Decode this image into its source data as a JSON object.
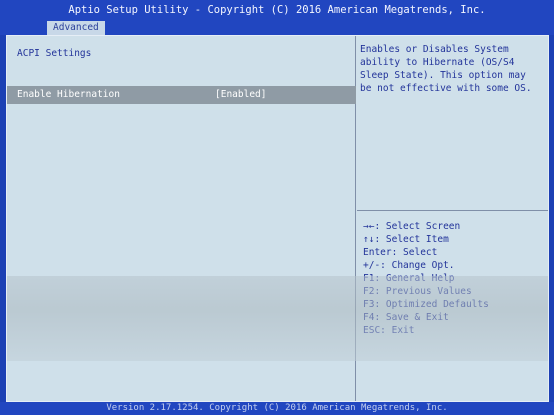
{
  "header": {
    "title": "Aptio Setup Utility - Copyright (C) 2016 American Megatrends, Inc."
  },
  "tabs": [
    {
      "label": "Advanced",
      "active": true
    }
  ],
  "main": {
    "section_title": "ACPI Settings",
    "items": [
      {
        "label": "Enable Hibernation",
        "value": "[Enabled]",
        "selected": true
      }
    ]
  },
  "help": {
    "lines": [
      "Enables or Disables System",
      "ability to Hibernate (OS/S4",
      "Sleep State). This option may",
      "be not effective with some OS."
    ]
  },
  "keys": [
    "→←: Select Screen",
    "↑↓: Select Item",
    "Enter: Select",
    "+/-: Change Opt.",
    "F1: General Help",
    "F2: Previous Values",
    "F3: Optimized Defaults",
    "F4: Save & Exit",
    "ESC: Exit"
  ],
  "footer": {
    "version": "Version 2.17.1254. Copyright (C) 2016 American Megatrends, Inc."
  },
  "colors": {
    "frame_blue": "#1c40b4",
    "panel_bg": "#cfe0ea",
    "text_blue": "#23349a",
    "highlight_row": "#8f9ba5"
  }
}
